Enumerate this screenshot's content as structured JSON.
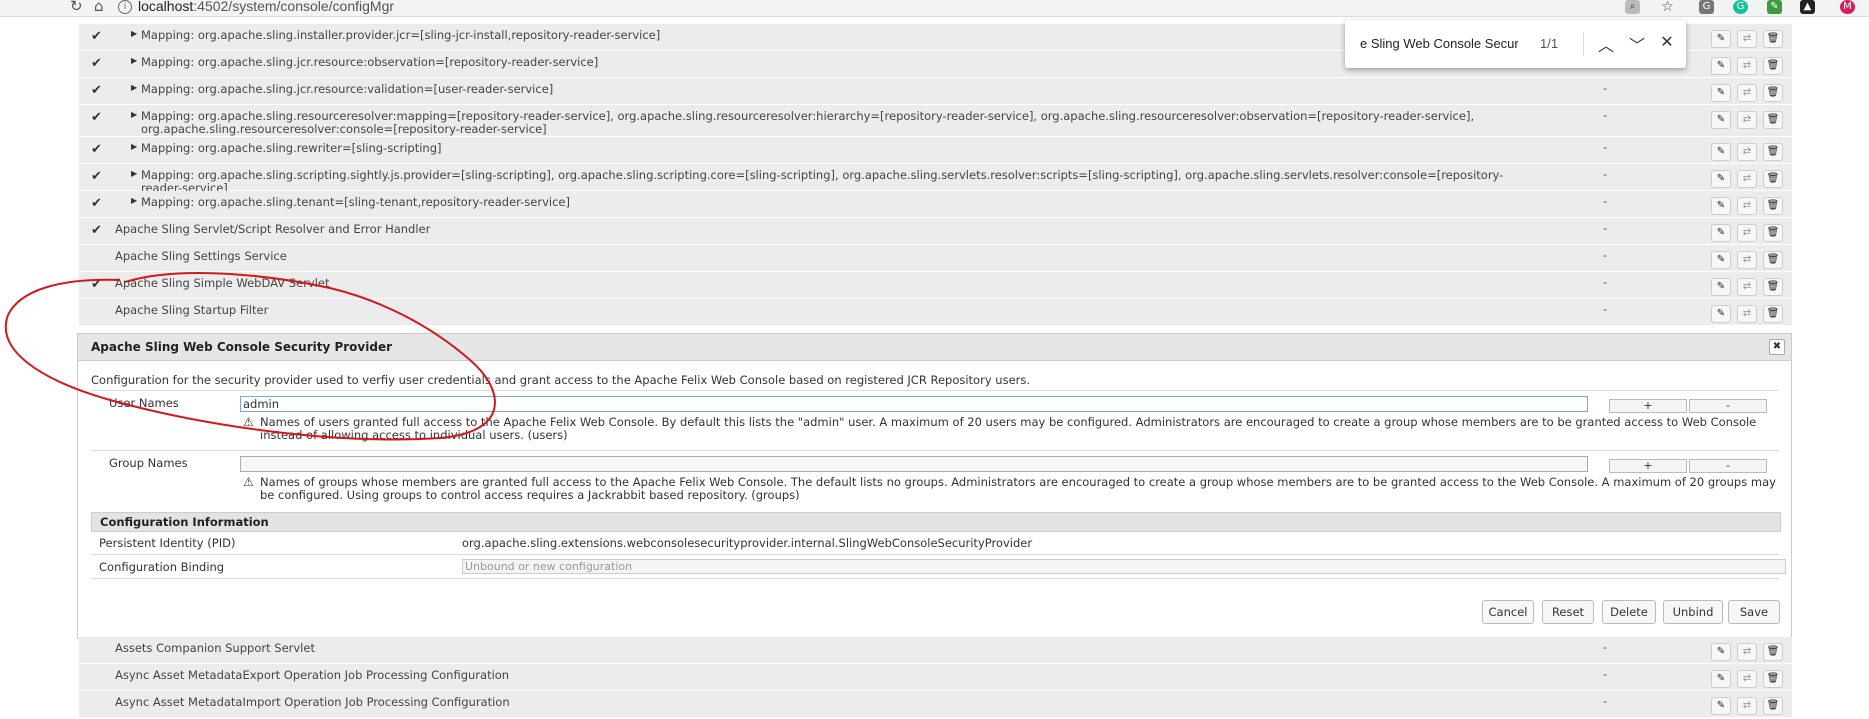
{
  "browser": {
    "url_host": "localhost",
    "url_path": ":4502/system/console/configMgr",
    "avatar_letter": "M"
  },
  "find": {
    "query": "e Sling Web Console Security P",
    "count": "1/1"
  },
  "rows_top": [
    {
      "check": true,
      "mapping": true,
      "label": "Mapping: org.apache.sling.installer.provider.jcr=[sling-jcr-install,repository-reader-service]",
      "dash": ""
    },
    {
      "check": true,
      "mapping": true,
      "label": "Mapping: org.apache.sling.jcr.resource:observation=[repository-reader-service]",
      "dash": ""
    },
    {
      "check": true,
      "mapping": true,
      "label": "Mapping: org.apache.sling.jcr.resource:validation=[user-reader-service]",
      "dash": "-"
    },
    {
      "check": true,
      "mapping": true,
      "tall": true,
      "label": "Mapping: org.apache.sling.resourceresolver:mapping=[repository-reader-service], org.apache.sling.resourceresolver:hierarchy=[repository-reader-service], org.apache.sling.resourceresolver:observation=[repository-reader-service], org.apache.sling.resourceresolver:console=[repository-reader-service]",
      "dash": "-"
    },
    {
      "check": true,
      "mapping": true,
      "label": "Mapping: org.apache.sling.rewriter=[sling-scripting]",
      "dash": "-"
    },
    {
      "check": true,
      "mapping": true,
      "label": "Mapping: org.apache.sling.scripting.sightly.js.provider=[sling-scripting], org.apache.sling.scripting.core=[sling-scripting], org.apache.sling.servlets.resolver:scripts=[sling-scripting], org.apache.sling.servlets.resolver:console=[repository-reader-service]",
      "dash": "-"
    },
    {
      "check": true,
      "mapping": true,
      "label": "Mapping: org.apache.sling.tenant=[sling-tenant,repository-reader-service]",
      "dash": "-"
    },
    {
      "check": true,
      "mapping": false,
      "label": "Apache Sling Servlet/Script Resolver and Error Handler",
      "dash": "-"
    },
    {
      "check": false,
      "mapping": false,
      "label": "Apache Sling Settings Service",
      "dash": "-"
    },
    {
      "check": true,
      "mapping": false,
      "label": "Apache Sling Simple WebDAV Servlet",
      "dash": "-"
    },
    {
      "check": false,
      "mapping": false,
      "label": "Apache Sling Startup Filter",
      "dash": "-"
    }
  ],
  "dialog": {
    "title": "Apache Sling Web Console Security Provider",
    "close": "✖",
    "description": "Configuration for the security provider used to verfiy user credentials and grant access to the Apache Felix Web Console based on registered JCR Repository users.",
    "user_names": {
      "label": "User Names",
      "value": "admin",
      "plus": "+",
      "minus": "-",
      "help": "Names of users granted full access to the Apache Felix Web Console. By default this lists the \"admin\" user. A maximum of 20 users may be configured. Administrators are encouraged to create a group whose members are to be granted access to Web Console instead of allowing access to individual users. (users)"
    },
    "group_names": {
      "label": "Group Names",
      "value": "",
      "plus": "+",
      "minus": "-",
      "help": "Names of groups whose members are granted full access to the Apache Felix Web Console. The default lists no groups. Administrators are encouraged to create a group whose members are to be granted access to the Web Console. A maximum of 20 groups may be configured. Using groups to control access requires a Jackrabbit based repository. (groups)"
    },
    "config_info": {
      "heading": "Configuration Information",
      "pid_label": "Persistent Identity (PID)",
      "pid_value": "org.apache.sling.extensions.webconsolesecurityprovider.internal.SlingWebConsoleSecurityProvider",
      "binding_label": "Configuration Binding",
      "binding_placeholder": "Unbound or new configuration"
    },
    "buttons": {
      "cancel": "Cancel",
      "reset": "Reset",
      "delete": "Delete",
      "unbind": "Unbind",
      "save": "Save"
    }
  },
  "rows_bottom": [
    {
      "check": false,
      "label": "Assets Companion Support Servlet",
      "dash": "-"
    },
    {
      "check": false,
      "label": "Async Asset MetadataExport Operation Job Processing Configuration",
      "dash": "-"
    },
    {
      "check": false,
      "label": "Async Asset MetadataImport Operation Job Processing Configuration",
      "dash": "-"
    }
  ],
  "colors": {
    "annotation": "#d11a1a",
    "row_bg": "#ececec"
  }
}
